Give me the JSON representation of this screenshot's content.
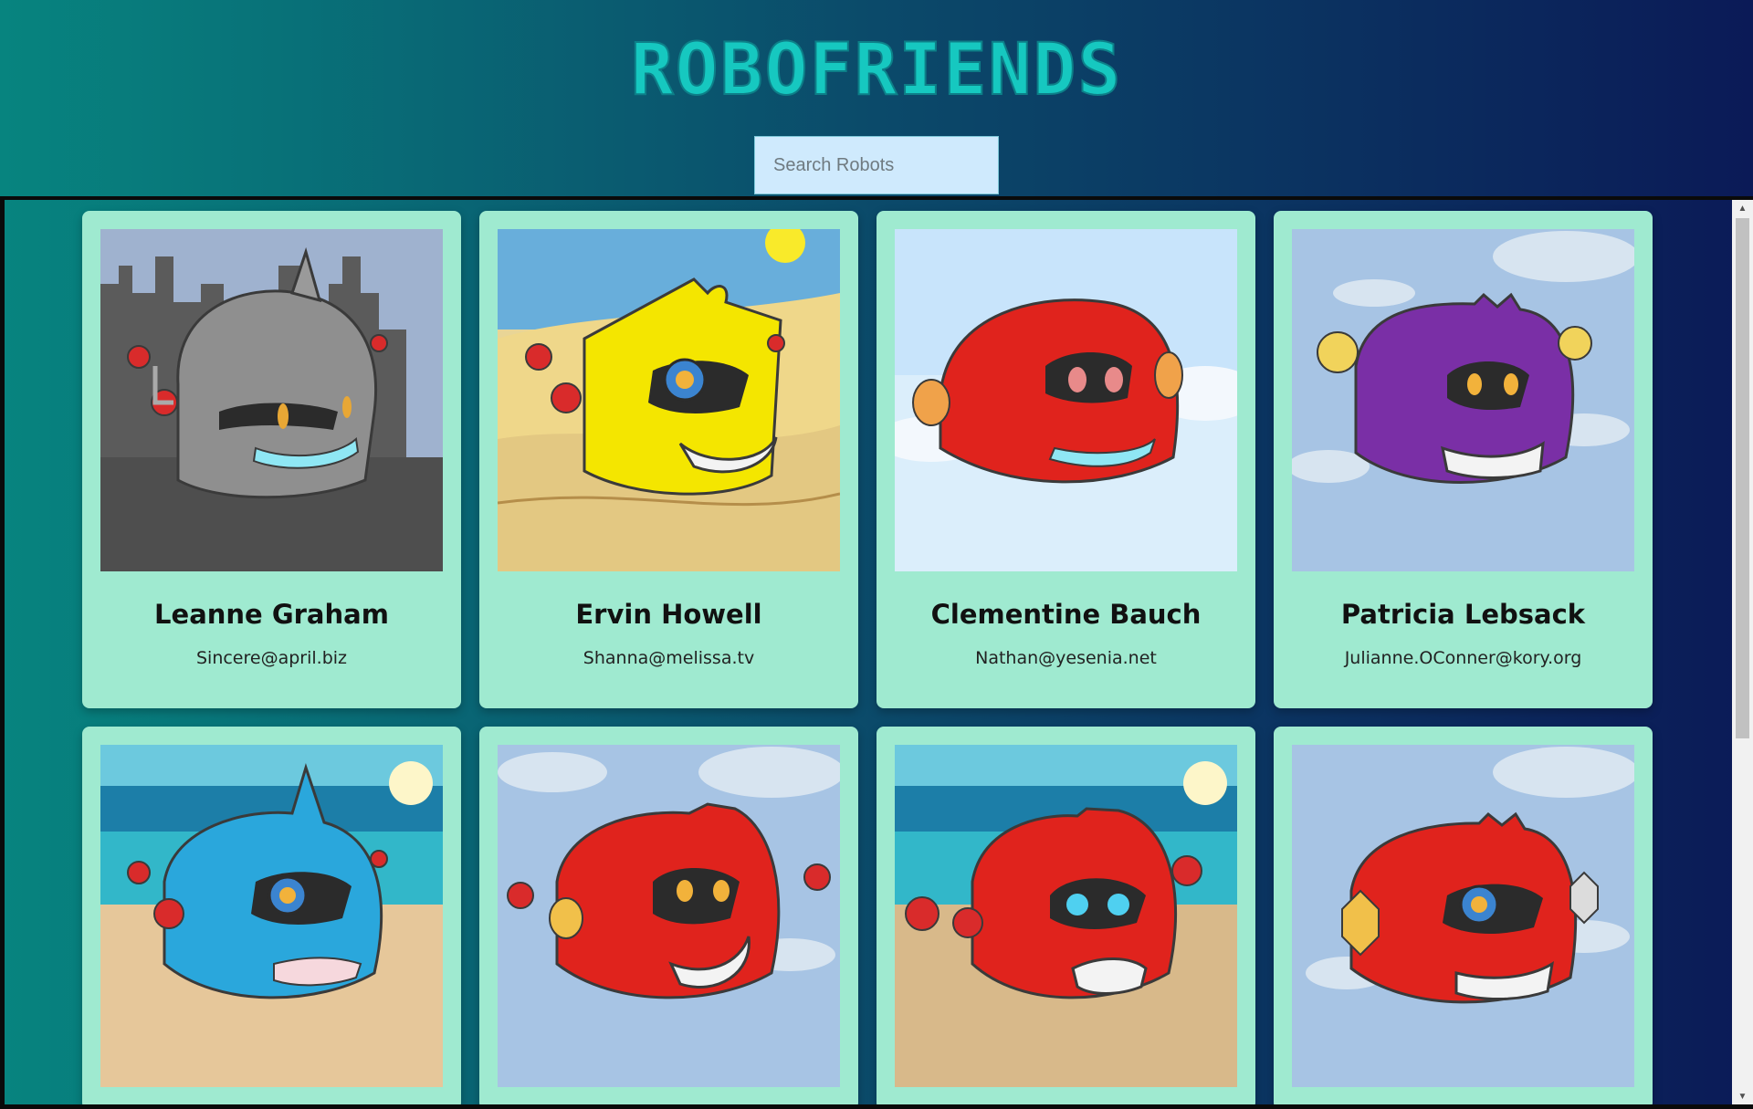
{
  "app": {
    "title": "ROBOFRIENDS"
  },
  "search": {
    "placeholder": "Search Robots"
  },
  "robots": [
    {
      "name": "Leanne Graham",
      "email": "Sincere@april.biz",
      "color": "#9a9a9a",
      "bg": "city-gray"
    },
    {
      "name": "Ervin Howell",
      "email": "Shanna@melissa.tv",
      "color": "#f4e600",
      "bg": "desert"
    },
    {
      "name": "Clementine Bauch",
      "email": "Nathan@yesenia.net",
      "color": "#e0231d",
      "bg": "sky-light"
    },
    {
      "name": "Patricia Lebsack",
      "email": "Julianne.OConner@kory.org",
      "color": "#7a2fa6",
      "bg": "sky-clouds"
    },
    {
      "name": "",
      "email": "",
      "color": "#2aa7dc",
      "bg": "beach"
    },
    {
      "name": "",
      "email": "",
      "color": "#e0231d",
      "bg": "sky-clouds"
    },
    {
      "name": "",
      "email": "",
      "color": "#e0231d",
      "bg": "beach"
    },
    {
      "name": "",
      "email": "",
      "color": "#e0231d",
      "bg": "sky-clouds"
    }
  ],
  "colors": {
    "card": "#9fead0",
    "title": "#16c8c0",
    "search_bg": "#cfeafd"
  }
}
